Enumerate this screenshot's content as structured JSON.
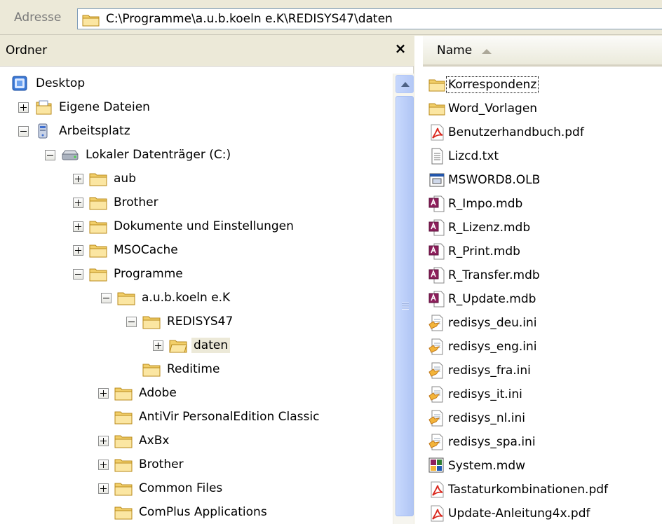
{
  "address": {
    "label": "Adresse",
    "path": "C:\\Programme\\a.u.b.koeln e.K\\REDISYS47\\daten"
  },
  "folders_pane": {
    "title": "Ordner",
    "close": "×"
  },
  "tree": [
    {
      "label": "Desktop",
      "icon": "desktop-icon",
      "expander": "none"
    },
    {
      "label": "Eigene Dateien",
      "icon": "my-documents-icon",
      "expander": "plus"
    },
    {
      "label": "Arbeitsplatz",
      "icon": "my-computer-icon",
      "expander": "minus"
    },
    {
      "label": "Lokaler Datenträger (C:)",
      "icon": "drive-icon",
      "expander": "minus"
    },
    {
      "label": "aub",
      "icon": "folder-icon",
      "expander": "plus"
    },
    {
      "label": "Brother",
      "icon": "folder-icon",
      "expander": "plus"
    },
    {
      "label": "Dokumente und Einstellungen",
      "icon": "folder-icon",
      "expander": "plus"
    },
    {
      "label": "MSOCache",
      "icon": "folder-icon",
      "expander": "plus"
    },
    {
      "label": "Programme",
      "icon": "folder-icon",
      "expander": "minus"
    },
    {
      "label": "a.u.b.koeln e.K",
      "icon": "folder-icon",
      "expander": "minus"
    },
    {
      "label": "REDISYS47",
      "icon": "folder-icon",
      "expander": "minus"
    },
    {
      "label": "daten",
      "icon": "folder-icon",
      "expander": "plus",
      "selected": true
    },
    {
      "label": "Reditime",
      "icon": "folder-icon",
      "expander": "none"
    },
    {
      "label": "Adobe",
      "icon": "folder-icon",
      "expander": "plus"
    },
    {
      "label": "AntiVir PersonalEdition Classic",
      "icon": "folder-icon",
      "expander": "none"
    },
    {
      "label": "AxBx",
      "icon": "folder-icon",
      "expander": "plus"
    },
    {
      "label": "Brother",
      "icon": "folder-icon",
      "expander": "plus"
    },
    {
      "label": "Common Files",
      "icon": "folder-icon",
      "expander": "plus"
    },
    {
      "label": "ComPlus Applications",
      "icon": "folder-icon",
      "expander": "none"
    }
  ],
  "file_list": {
    "column_name": "Name",
    "files": [
      {
        "name": "Korrespondenz",
        "type": "folder",
        "focused": true
      },
      {
        "name": "Word_Vorlagen",
        "type": "folder"
      },
      {
        "name": "Benutzerhandbuch.pdf",
        "type": "pdf"
      },
      {
        "name": "Lizcd.txt",
        "type": "txt"
      },
      {
        "name": "MSWORD8.OLB",
        "type": "olb"
      },
      {
        "name": "R_Impo.mdb",
        "type": "mdb"
      },
      {
        "name": "R_Lizenz.mdb",
        "type": "mdb"
      },
      {
        "name": "R_Print.mdb",
        "type": "mdb"
      },
      {
        "name": "R_Transfer.mdb",
        "type": "mdb"
      },
      {
        "name": "R_Update.mdb",
        "type": "mdb"
      },
      {
        "name": "redisys_deu.ini",
        "type": "ini"
      },
      {
        "name": "redisys_eng.ini",
        "type": "ini"
      },
      {
        "name": "redisys_fra.ini",
        "type": "ini"
      },
      {
        "name": "redisys_it.ini",
        "type": "ini"
      },
      {
        "name": "redisys_nl.ini",
        "type": "ini"
      },
      {
        "name": "redisys_spa.ini",
        "type": "ini"
      },
      {
        "name": "System.mdw",
        "type": "mdw"
      },
      {
        "name": "Tastaturkombinationen.pdf",
        "type": "pdf"
      },
      {
        "name": "Update-Anleitung4x.pdf",
        "type": "pdf"
      }
    ]
  },
  "colors": {
    "folder": "#f5d87a",
    "pdf": "#d9261c",
    "mdb": "#8e1f5c",
    "selection": "#ece9d8",
    "scrollbar": "#c1d3fb"
  }
}
